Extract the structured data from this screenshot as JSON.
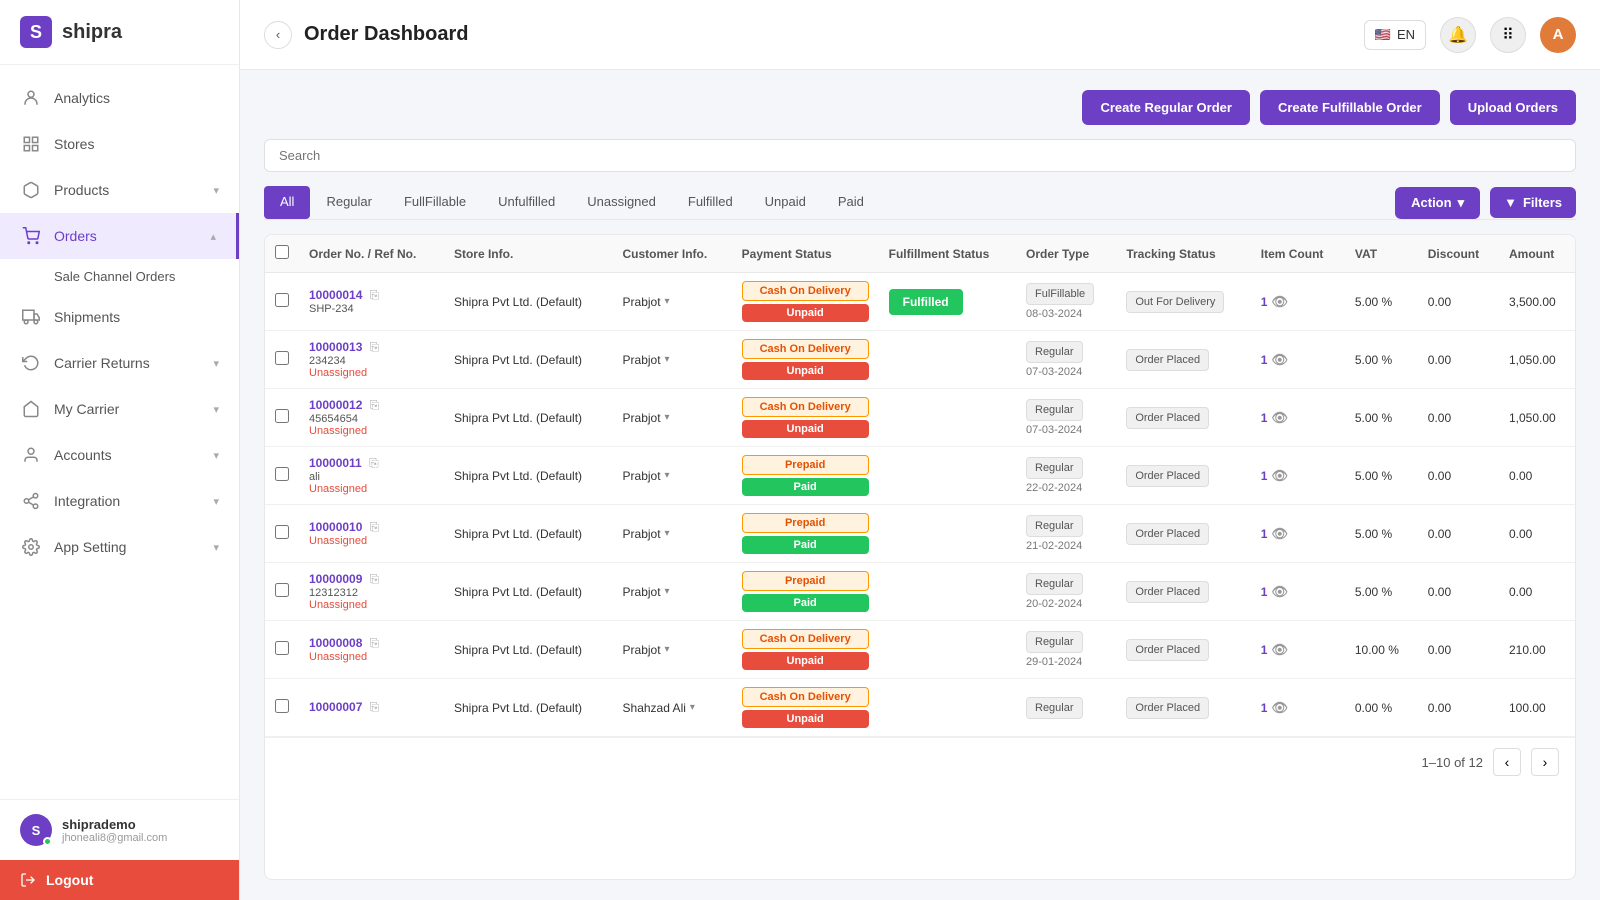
{
  "app": {
    "name": "shipra",
    "logo_letter": "S"
  },
  "header": {
    "title": "Order Dashboard",
    "lang": "EN",
    "collapse_icon": "‹"
  },
  "sidebar": {
    "items": [
      {
        "id": "analytics",
        "label": "Analytics",
        "icon": "person",
        "has_children": false
      },
      {
        "id": "stores",
        "label": "Stores",
        "icon": "grid",
        "has_children": false
      },
      {
        "id": "products",
        "label": "Products",
        "icon": "box",
        "has_children": true
      },
      {
        "id": "orders",
        "label": "Orders",
        "icon": "cart",
        "has_children": true,
        "active": true
      },
      {
        "id": "shipments",
        "label": "Shipments",
        "icon": "truck",
        "has_children": false
      },
      {
        "id": "carrier-returns",
        "label": "Carrier Returns",
        "icon": "return",
        "has_children": true
      },
      {
        "id": "my-carrier",
        "label": "My Carrier",
        "icon": "carrier",
        "has_children": true
      },
      {
        "id": "accounts",
        "label": "Accounts",
        "icon": "account",
        "has_children": true
      },
      {
        "id": "integration",
        "label": "Integration",
        "icon": "integration",
        "has_children": true
      },
      {
        "id": "app-setting",
        "label": "App Setting",
        "icon": "gear",
        "has_children": true
      }
    ],
    "sub_items": [
      "Sale Channel Orders"
    ],
    "user": {
      "name": "shiprademo",
      "email": "jhoneali8@gmail.com",
      "initials": "S"
    },
    "logout_label": "Logout"
  },
  "toolbar": {
    "create_regular_label": "Create Regular Order",
    "create_fulfillable_label": "Create Fulfillable Order",
    "upload_orders_label": "Upload Orders"
  },
  "search": {
    "placeholder": "Search"
  },
  "tabs": [
    {
      "id": "all",
      "label": "All",
      "active": true
    },
    {
      "id": "regular",
      "label": "Regular",
      "active": false
    },
    {
      "id": "fullfillable",
      "label": "FullFillable",
      "active": false
    },
    {
      "id": "unfulfilled",
      "label": "Unfulfilled",
      "active": false
    },
    {
      "id": "unassigned",
      "label": "Unassigned",
      "active": false
    },
    {
      "id": "fulfilled",
      "label": "Fulfilled",
      "active": false
    },
    {
      "id": "unpaid",
      "label": "Unpaid",
      "active": false
    },
    {
      "id": "paid",
      "label": "Paid",
      "active": false
    }
  ],
  "action_button": "Action",
  "filter_button": "Filters",
  "table": {
    "columns": [
      "Order No. / Ref No.",
      "Store Info.",
      "Customer Info.",
      "Payment Status",
      "Fulfillment Status",
      "Order Type",
      "Tracking Status",
      "Item Count",
      "VAT",
      "Discount",
      "Amount"
    ],
    "rows": [
      {
        "order_no": "10000014",
        "ref_no": "SHP-234",
        "ref_status": "",
        "store": "Shipra Pvt Ltd. (Default)",
        "customer": "Prabjot",
        "payment_method": "Cash On Delivery",
        "payment_status": "Unpaid",
        "fulfillment_status": "Fulfilled",
        "order_type": "FulFillable",
        "order_date": "08-03-2024",
        "tracking_status": "Out For Delivery",
        "item_count": "1",
        "vat": "5.00 %",
        "discount": "0.00",
        "amount": "3,500.00"
      },
      {
        "order_no": "10000013",
        "ref_no": "234234",
        "ref_status": "Unassigned",
        "store": "Shipra Pvt Ltd. (Default)",
        "customer": "Prabjot",
        "payment_method": "Cash On Delivery",
        "payment_status": "Unpaid",
        "fulfillment_status": "",
        "order_type": "Regular",
        "order_date": "07-03-2024",
        "tracking_status": "Order Placed",
        "item_count": "1",
        "vat": "5.00 %",
        "discount": "0.00",
        "amount": "1,050.00"
      },
      {
        "order_no": "10000012",
        "ref_no": "45654654",
        "ref_status": "Unassigned",
        "store": "Shipra Pvt Ltd. (Default)",
        "customer": "Prabjot",
        "payment_method": "Cash On Delivery",
        "payment_status": "Unpaid",
        "fulfillment_status": "",
        "order_type": "Regular",
        "order_date": "07-03-2024",
        "tracking_status": "Order Placed",
        "item_count": "1",
        "vat": "5.00 %",
        "discount": "0.00",
        "amount": "1,050.00"
      },
      {
        "order_no": "10000011",
        "ref_no": "ali",
        "ref_status": "Unassigned",
        "store": "Shipra Pvt Ltd. (Default)",
        "customer": "Prabjot",
        "payment_method": "Prepaid",
        "payment_status": "Paid",
        "fulfillment_status": "",
        "order_type": "Regular",
        "order_date": "22-02-2024",
        "tracking_status": "Order Placed",
        "item_count": "1",
        "vat": "5.00 %",
        "discount": "0.00",
        "amount": "0.00"
      },
      {
        "order_no": "10000010",
        "ref_no": "",
        "ref_status": "Unassigned",
        "store": "Shipra Pvt Ltd. (Default)",
        "customer": "Prabjot",
        "payment_method": "Prepaid",
        "payment_status": "Paid",
        "fulfillment_status": "",
        "order_type": "Regular",
        "order_date": "21-02-2024",
        "tracking_status": "Order Placed",
        "item_count": "1",
        "vat": "5.00 %",
        "discount": "0.00",
        "amount": "0.00"
      },
      {
        "order_no": "10000009",
        "ref_no": "12312312",
        "ref_status": "Unassigned",
        "store": "Shipra Pvt Ltd. (Default)",
        "customer": "Prabjot",
        "payment_method": "Prepaid",
        "payment_status": "Paid",
        "fulfillment_status": "",
        "order_type": "Regular",
        "order_date": "20-02-2024",
        "tracking_status": "Order Placed",
        "item_count": "1",
        "vat": "5.00 %",
        "discount": "0.00",
        "amount": "0.00"
      },
      {
        "order_no": "10000008",
        "ref_no": "",
        "ref_status": "Unassigned",
        "store": "Shipra Pvt Ltd. (Default)",
        "customer": "Prabjot",
        "payment_method": "Cash On Delivery",
        "payment_status": "Unpaid",
        "fulfillment_status": "",
        "order_type": "Regular",
        "order_date": "29-01-2024",
        "tracking_status": "Order Placed",
        "item_count": "1",
        "vat": "10.00 %",
        "discount": "0.00",
        "amount": "210.00"
      },
      {
        "order_no": "10000007",
        "ref_no": "",
        "ref_status": "",
        "store": "Shipra Pvt Ltd. (Default)",
        "customer": "Shahzad Ali",
        "payment_method": "Cash On Delivery",
        "payment_status": "Unpaid",
        "fulfillment_status": "",
        "order_type": "Regular",
        "order_date": "",
        "tracking_status": "Order Placed",
        "item_count": "1",
        "vat": "0.00 %",
        "discount": "0.00",
        "amount": "100.00"
      }
    ]
  },
  "pagination": {
    "range": "1–10 of 12",
    "prev_icon": "‹",
    "next_icon": "›"
  }
}
